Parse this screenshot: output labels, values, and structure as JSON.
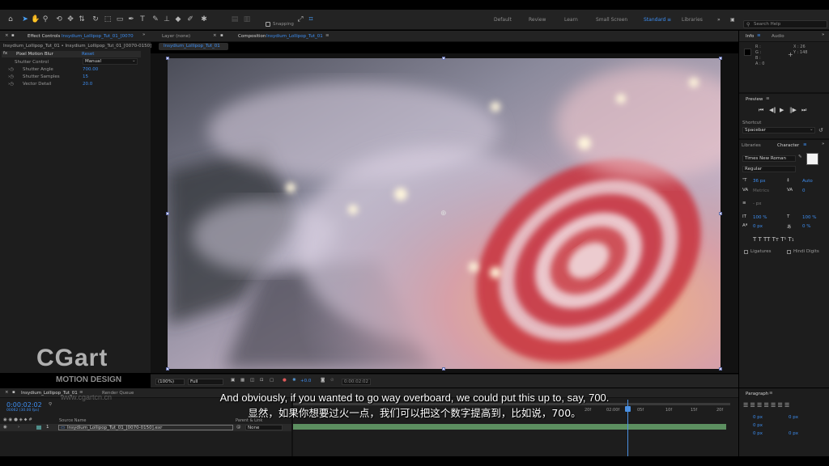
{
  "toolbar": {
    "snapping_label": "Snapping",
    "workspaces": [
      "Default",
      "Review",
      "Learn",
      "Small Screen",
      "Standard",
      "Libraries"
    ],
    "active_workspace": "Standard",
    "search_placeholder": "Search Help"
  },
  "effect_controls": {
    "tab_label": "Effect Controls",
    "tab_source": "Insydium_Lollipop_Tut_01_[0070",
    "breadcrumb": "Insydium_Lollipop_Tut_01 • Insydium_Lollipop_Tut_01_[0070-0150]",
    "effect_name": "Pixel Motion Blur",
    "reset_label": "Reset",
    "properties": [
      {
        "label": "Shutter Control",
        "value": "Manual"
      },
      {
        "label": "Shutter Angle",
        "value": "700.00"
      },
      {
        "label": "Shutter Samples",
        "value": "15"
      },
      {
        "label": "Vector Detail",
        "value": "20.0"
      }
    ]
  },
  "composition": {
    "layer_tab": "Layer (none)",
    "comp_tab_label": "Composition",
    "comp_tab_name": "Insydium_Lollipop_Tut_01",
    "breadcrumb": "Insydium_Lollipop_Tut_01",
    "zoom": "(100%)",
    "resolution": "Full",
    "exposure": "+0.0",
    "timecode": "0:00:02:02"
  },
  "info": {
    "tabs": [
      "Info",
      "Audio"
    ],
    "r_label": "R :",
    "g_label": "G :",
    "b_label": "B :",
    "a_label": "A : 0",
    "x_readout": "X : 26",
    "y_readout": "Y : 148"
  },
  "preview": {
    "title": "Preview",
    "shortcut_label": "Shortcut",
    "shortcut_value": "Spacebar"
  },
  "character": {
    "tabs": [
      "Libraries",
      "Character"
    ],
    "font": "Times New Roman",
    "style": "Regular",
    "size": "36 px",
    "leading": "Auto",
    "kerning": "Metrics",
    "tracking": "0",
    "stroke": "- px",
    "vscale": "100 %",
    "hscale": "100 %",
    "baseline": "0 px",
    "tsume": "0 %",
    "ligatures": "Ligatures",
    "hindi": "Hindi Digits"
  },
  "paragraph": {
    "title": "Paragraph",
    "values": [
      "0 px",
      "0 px",
      "0 px",
      "0 px",
      "0 px"
    ]
  },
  "timeline": {
    "tab_name": "Insydium_Lollipop_Tut_01",
    "render_queue": "Render Queue",
    "timecode": "0:00:02:02",
    "frame_info": "00062 (30.00 fps)",
    "source_name_header": "Source Name",
    "parent_header": "Parent & Link",
    "layer_number": "1",
    "layer_name": "Insydium_Lollipop_Tut_01_[0070-0150].exr",
    "parent_value": "None",
    "ruler": [
      "20f",
      "02:00f",
      "05f",
      "10f",
      "15f",
      "20f"
    ],
    "playhead_fraction": 0.765
  },
  "watermark": {
    "brand": "CGart",
    "tagline": "MOTION DESIGN",
    "url": "www.cgartcn.cn"
  },
  "subtitles": {
    "english": "And obviously, if you wanted to go way overboard, we could put this up to, say, 700.",
    "chinese": "显然，如果你想要过火一点，我们可以把这个数字提高到，比如说，700。"
  }
}
